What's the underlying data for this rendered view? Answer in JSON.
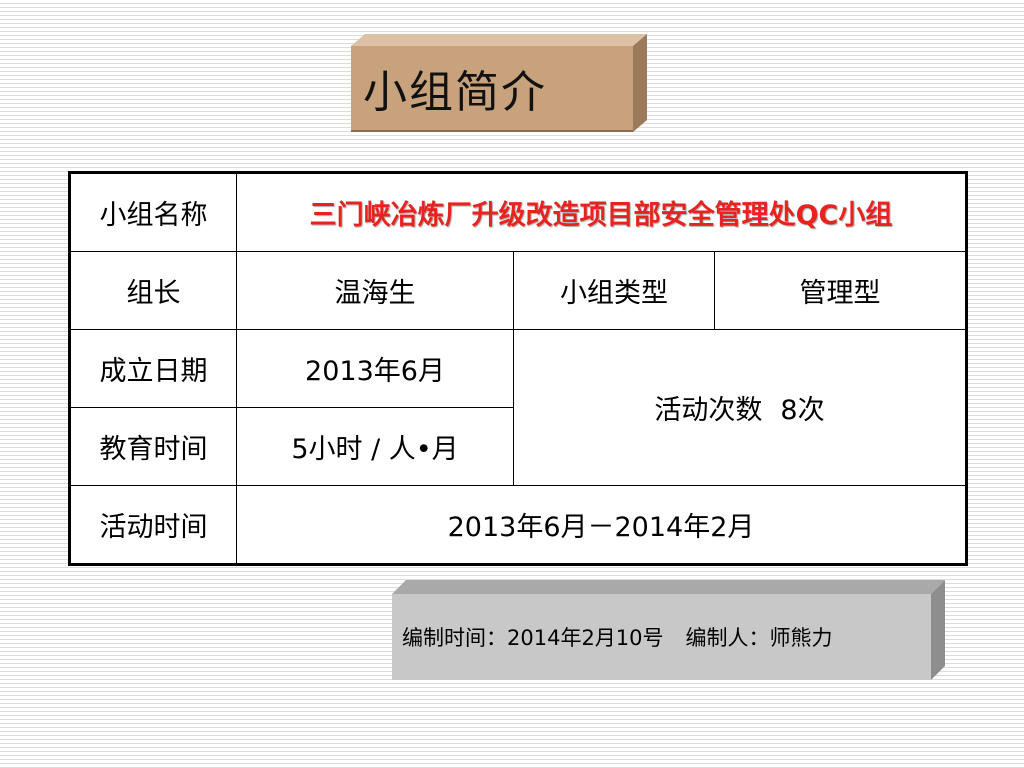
{
  "title": "小组简介",
  "table": {
    "group_name_label": "小组名称",
    "group_name_value": "三门峡冶炼厂升级改造项目部安全管理处QC小组",
    "leader_label": "组长",
    "leader_value": "温海生",
    "type_label": "小组类型",
    "type_value": "管理型",
    "founded_label": "成立日期",
    "founded_value": "2013年6月",
    "activity_count_label": "活动次数",
    "activity_count_value": "8次",
    "education_label": "教育时间",
    "education_value": "5小时 / 人•月",
    "activity_time_label": "活动时间",
    "activity_time_value": "2013年6月－2014年2月"
  },
  "footer": {
    "compiled_date": "编制时间：2014年2月10号",
    "compiled_by": "编制人：师熊力"
  },
  "colors": {
    "title_box": "#c8a27c",
    "highlight_text": "#e8231f",
    "footer_box": "#c8c8c8"
  }
}
